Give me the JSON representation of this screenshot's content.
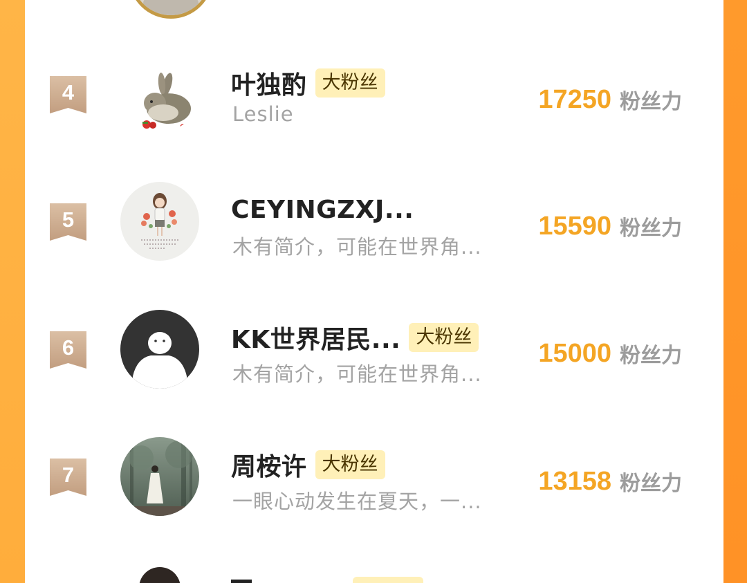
{
  "colors": {
    "score": "#f4a524",
    "badge_bg": "#fff0b8",
    "rank_badge": "#c9a585",
    "frame_orange": "#ffad3c"
  },
  "ranking": {
    "score_unit": "粉丝力",
    "rows": [
      {
        "rank": "4",
        "name": "叶独酌",
        "badge": "大粉丝",
        "subtitle": "Leslie",
        "score": "17250",
        "avatar": "rabbit-avatar"
      },
      {
        "rank": "5",
        "name": "CEYINGZXJ...",
        "badge": "",
        "subtitle": "木有简介，可能在世界角...",
        "score": "15590",
        "avatar": "girl-flowers-avatar"
      },
      {
        "rank": "6",
        "name": "KK世界居民...",
        "badge": "大粉丝",
        "subtitle": "木有简介，可能在世界角...",
        "score": "15000",
        "avatar": "default-user-avatar"
      },
      {
        "rank": "7",
        "name": "周桉许",
        "badge": "大粉丝",
        "subtitle": "一眼心动发生在夏天，一...",
        "score": "13158",
        "avatar": "forest-girl-avatar"
      }
    ]
  }
}
